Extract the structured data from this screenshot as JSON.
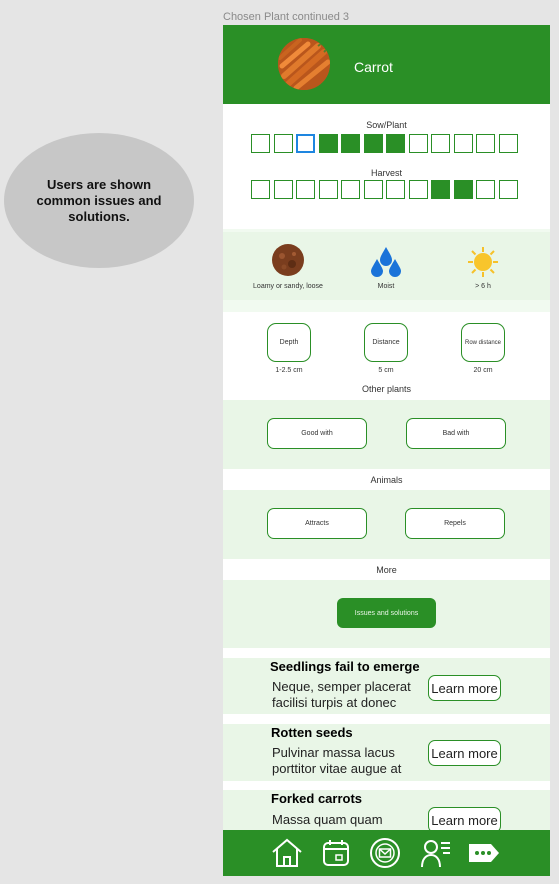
{
  "frame": {
    "label": "Chosen Plant continued 3"
  },
  "annotation": {
    "text": "Users are shown common issues and solutions."
  },
  "plant": {
    "name": "Carrot",
    "image_icon": "carrot-photo"
  },
  "calendar": {
    "sow_label": "Sow/Plant",
    "sow_months": [
      0,
      0,
      2,
      1,
      1,
      1,
      1,
      0,
      0,
      0,
      0,
      0
    ],
    "harvest_label": "Harvest",
    "harvest_months": [
      0,
      0,
      0,
      0,
      0,
      0,
      0,
      0,
      1,
      1,
      0,
      0
    ]
  },
  "conditions": [
    {
      "icon": "soil-icon",
      "label": "Loamy or sandy, loose"
    },
    {
      "icon": "water-drops-icon",
      "label": "Moist"
    },
    {
      "icon": "sun-icon",
      "label": "> 6 h"
    }
  ],
  "measurements": [
    {
      "title": "Depth",
      "value": "1-2.5 cm"
    },
    {
      "title": "Distance",
      "value": "5 cm"
    },
    {
      "title": "Row distance",
      "value": "20 cm"
    }
  ],
  "other_plants": {
    "heading": "Other plants",
    "good": "Good with",
    "bad": "Bad with"
  },
  "animals": {
    "heading": "Animals",
    "attracts": "Attracts",
    "repels": "Repels"
  },
  "more": {
    "heading": "More",
    "button": "Issues and solutions"
  },
  "issues": [
    {
      "title": "Seedlings fail to emerge",
      "desc": "Neque, semper placerat facilisi turpis at donec",
      "button": "Learn more"
    },
    {
      "title": "Rotten seeds",
      "desc": "Pulvinar massa lacus porttitor vitae augue at",
      "button": "Learn more"
    },
    {
      "title": "Forked carrots",
      "desc": "Massa quam quam",
      "button": "Learn more"
    }
  ],
  "nav": [
    {
      "icon": "home-icon"
    },
    {
      "icon": "calendar-icon"
    },
    {
      "icon": "mail-icon"
    },
    {
      "icon": "profile-list-icon"
    },
    {
      "icon": "more-tag-icon"
    }
  ],
  "colors": {
    "primary": "#2a8f26",
    "light_panel": "#e9f6e7",
    "highlight": "#1e86e0"
  }
}
